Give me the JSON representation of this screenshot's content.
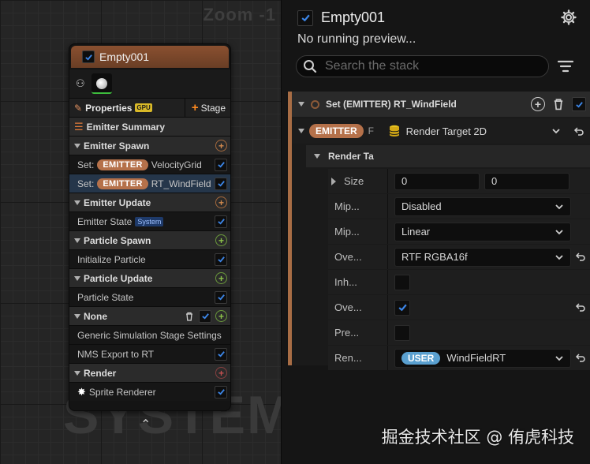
{
  "graph": {
    "zoom_label": "Zoom -1",
    "watermark": "SYSTEM",
    "node": {
      "title": "Empty001",
      "toolbar": {
        "properties": "Properties",
        "gpu_badge": "GPU",
        "stage": "Stage"
      },
      "emitter_summary": "Emitter Summary",
      "sections": {
        "emitter_spawn": "Emitter Spawn",
        "emitter_update": "Emitter Update",
        "particle_spawn": "Particle Spawn",
        "particle_update": "Particle Update",
        "none": "None",
        "render": "Render"
      },
      "items": {
        "set_prefix": "Set:",
        "emitter_pill": "EMITTER",
        "velocity_grid": "VelocityGrid",
        "rt_windfield": "RT_WindField",
        "emitter_state": "Emitter State",
        "system_badge": "System",
        "initialize_particle": "Initialize Particle",
        "particle_state": "Particle State",
        "generic_sim_stage": "Generic Simulation Stage Settings",
        "nms_export": "NMS Export to RT",
        "sprite_renderer": "Sprite Renderer"
      }
    }
  },
  "details": {
    "title": "Empty001",
    "status": "No running preview...",
    "search_placeholder": "Search the stack",
    "module_title": "Set (EMITTER) RT_WindField",
    "emitter_pill": "EMITTER",
    "emitter_trunc": "F",
    "type_label": "Render Target 2D",
    "render_section": "Render Ta",
    "props": {
      "size": {
        "label": "Size",
        "x": "0",
        "y": "0"
      },
      "mip1": {
        "label": "Mip...",
        "value": "Disabled"
      },
      "mip2": {
        "label": "Mip...",
        "value": "Linear"
      },
      "ove1": {
        "label": "Ove...",
        "value": "RTF RGBA16f"
      },
      "inh": {
        "label": "Inh..."
      },
      "ove2": {
        "label": "Ove..."
      },
      "pre": {
        "label": "Pre..."
      },
      "ren": {
        "label": "Ren...",
        "pill": "USER",
        "value": "WindFieldRT"
      }
    }
  },
  "watermark_text": "掘金技术社区 @ 侑虎科技"
}
